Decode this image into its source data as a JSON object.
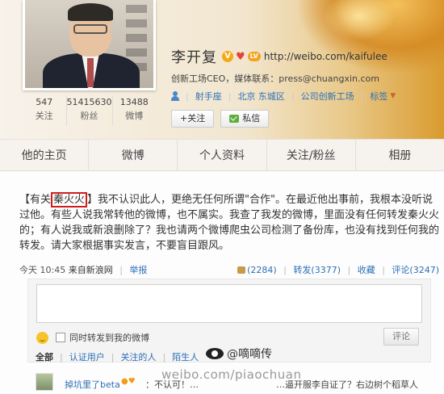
{
  "profile": {
    "name": "李开复",
    "url": "http://weibo.com/kaifulee",
    "badge_level": "LV",
    "description": "创新工场CEO，媒体联系：press@chuangxin.com",
    "stats": [
      {
        "num": "547",
        "label": "关注"
      },
      {
        "num": "51415630",
        "label": "粉丝"
      },
      {
        "num": "13488",
        "label": "微博"
      }
    ],
    "zodiac": "射手座",
    "location": "北京 东城区",
    "company": "公司创新工场",
    "tag_label": "标签",
    "follow_button": "+关注",
    "message_button": "私信",
    "colors": {
      "verified": "#f6a915",
      "link": "#2d6fb7",
      "highlight_box": "#d21c1c"
    }
  },
  "tabs": [
    {
      "label": "他的主页"
    },
    {
      "label": "微博"
    },
    {
      "label": "个人资料"
    },
    {
      "label": "关注/粉丝"
    },
    {
      "label": "相册"
    }
  ],
  "post": {
    "text_prefix": "【有关",
    "highlight": "秦火火",
    "text_rest": "】我不认识此人，更绝无任何所谓\"合作\"。在最近他出事前，我根本没听说过他。有些人说我常转他的微博，也不属实。我查了我发的微博，里面没有任何转发秦火火的；有人说我或新浪删除了？我也请两个微博爬虫公司检测了备份库，也没有找到任何我的转发。请大家根据事实发言，不要盲目跟风。",
    "time": "今天 10:45",
    "source": "来自新浪网",
    "report": "举报",
    "likes": "(2284)",
    "repost": "转发(3377)",
    "favorite": "收藏",
    "comments": "评论(3247)"
  },
  "comment_box": {
    "also_repost_label": "同时转发到我的微博",
    "submit_label": "评论"
  },
  "filters": [
    {
      "label": "全部"
    },
    {
      "label": "认证用户"
    },
    {
      "label": "关注的人"
    },
    {
      "label": "陌生人"
    }
  ],
  "watermark": {
    "name": "@嘀嘀传",
    "url": "weibo.com/piaochuan"
  },
  "comment_preview": {
    "user": "掉坑里了beta",
    "text_a": "：不认可！…",
    "text_b": "…逼开服李自证了？右边树个稻草人"
  }
}
